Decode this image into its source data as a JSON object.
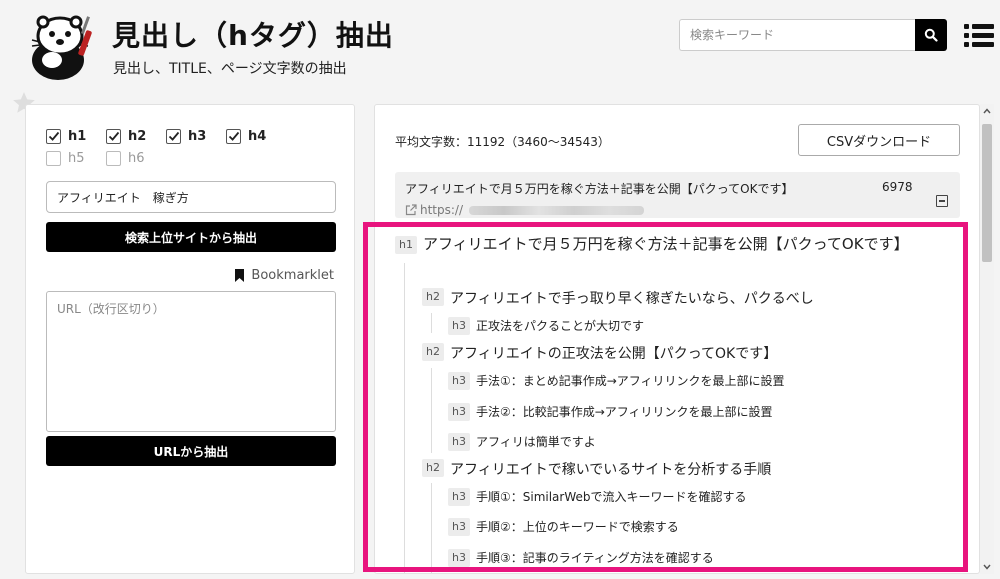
{
  "header": {
    "title": "見出し（hタグ）抽出",
    "subtitle": "見出し、TITLE、ページ文字数の抽出",
    "search_placeholder": "検索キーワード"
  },
  "filters": {
    "row1": [
      {
        "label": "h1",
        "checked": true
      },
      {
        "label": "h2",
        "checked": true
      },
      {
        "label": "h3",
        "checked": true
      },
      {
        "label": "h4",
        "checked": true
      }
    ],
    "row2": [
      {
        "label": "h5",
        "checked": false
      },
      {
        "label": "h6",
        "checked": false
      }
    ]
  },
  "left": {
    "keyword_value": "アフィリエイト　稼ぎ方",
    "extract_search_label": "検索上位サイトから抽出",
    "bookmarklet_label": "Bookmarklet",
    "url_placeholder": "URL（改行区切り）",
    "extract_url_label": "URLから抽出"
  },
  "right": {
    "avg_text": "平均文字数：11192（3460～34543）",
    "csv_label": "CSVダウンロード",
    "result": {
      "title": "アフィリエイトで月５万円を稼ぐ方法＋記事を公開【パクってOKです】",
      "count": "6978",
      "url": "https://"
    },
    "headings": [
      {
        "tag": "h1",
        "text": "アフィリエイトで月５万円を稼ぐ方法＋記事を公開【パクってOKです】"
      },
      {
        "tag": "h2",
        "text": "アフィリエイトで手っ取り早く稼ぎたいなら、パクるべし"
      },
      {
        "tag": "h3",
        "text": "正攻法をパクることが大切です"
      },
      {
        "tag": "h2",
        "text": "アフィリエイトの正攻法を公開【パクってOKです】"
      },
      {
        "tag": "h3",
        "text": "手法①：まとめ記事作成→アフィリリンクを最上部に設置"
      },
      {
        "tag": "h3",
        "text": "手法②：比較記事作成→アフィリリンクを最上部に設置"
      },
      {
        "tag": "h3",
        "text": "アフィリは簡単ですよ"
      },
      {
        "tag": "h2",
        "text": "アフィリエイトで稼いでいるサイトを分析する手順"
      },
      {
        "tag": "h3",
        "text": "手順①：SimilarWebで流入キーワードを確認する"
      },
      {
        "tag": "h3",
        "text": "手順②：上位のキーワードで検索する"
      },
      {
        "tag": "h3",
        "text": "手順③：記事のライティング方法を確認する"
      }
    ]
  },
  "colors": {
    "highlight": "#e8147e",
    "button": "#000000"
  }
}
